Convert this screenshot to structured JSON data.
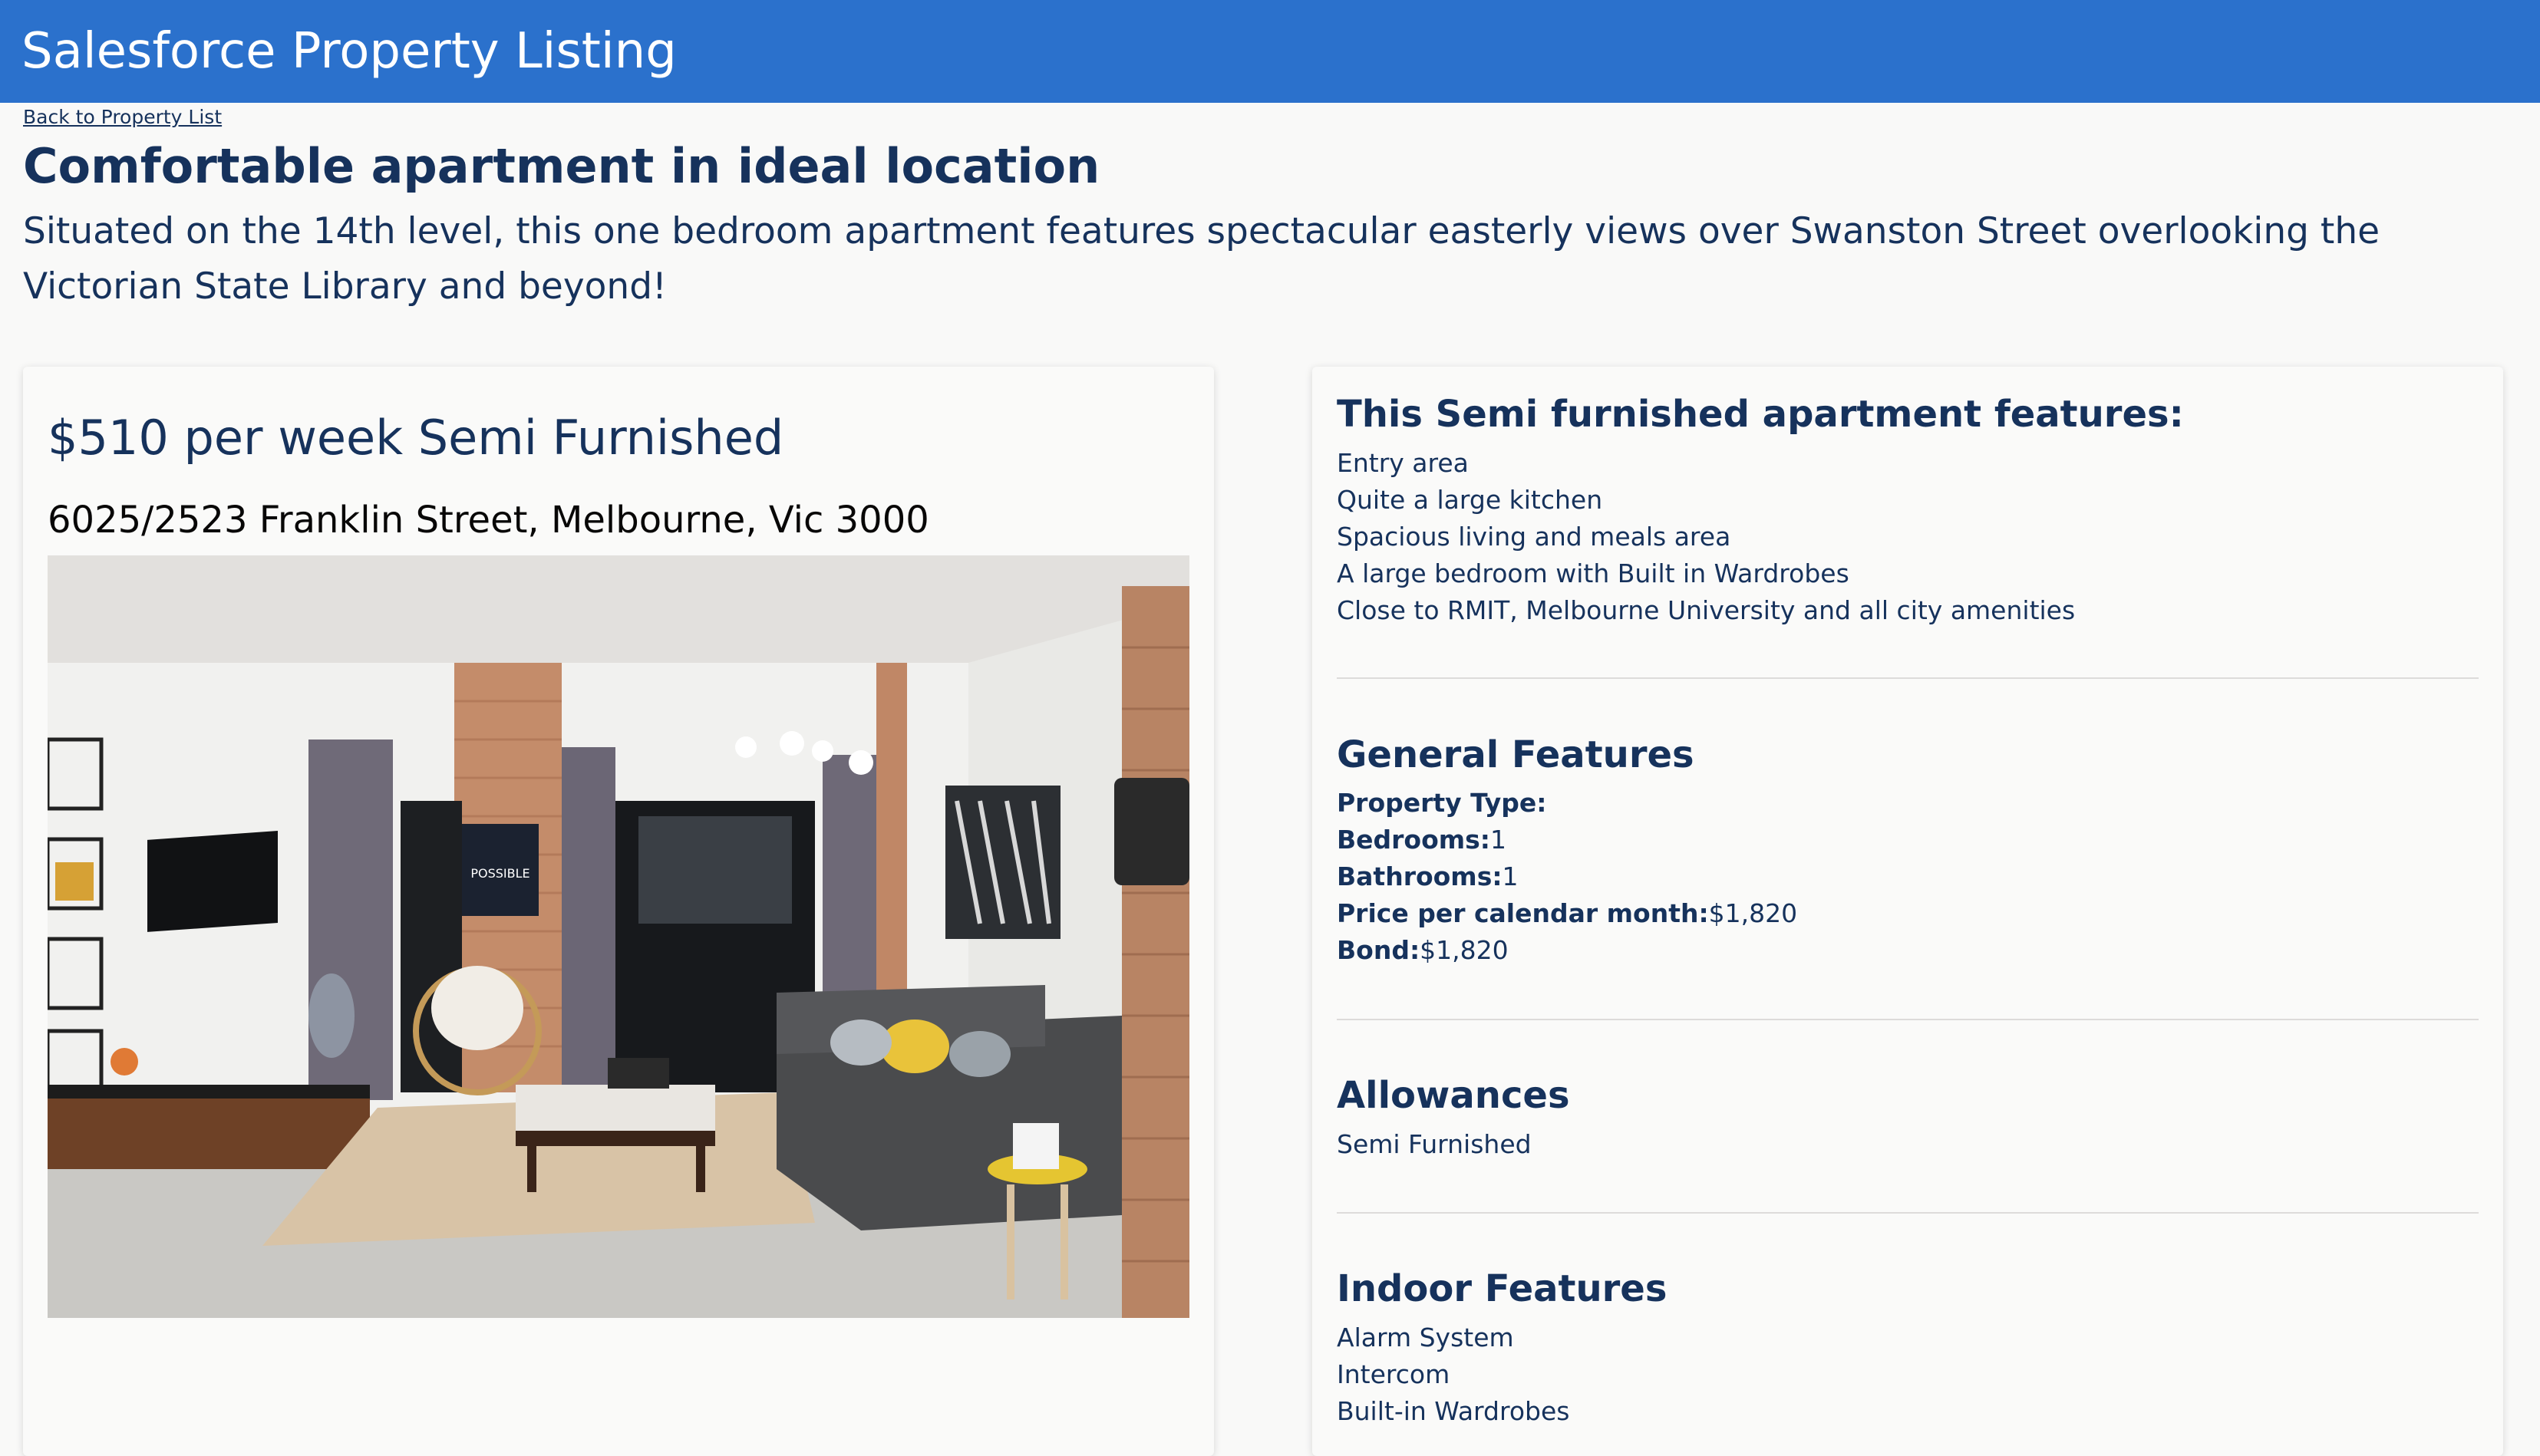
{
  "header": {
    "title": "Salesforce Property Listing"
  },
  "nav": {
    "back_link": "Back to Property List"
  },
  "listing": {
    "title": "Comfortable apartment in ideal location",
    "description": "Situated on the 14th level, this one bedroom apartment features spectacular easterly views over Swanston Street overlooking the Victorian State Library and beyond!",
    "price_line": "$510 per week Semi Furnished",
    "address": "6025/2523 Franklin Street, Melbourne, Vic 3000",
    "photo_caption": "POSSIBLE"
  },
  "features": {
    "heading": "This Semi furnished apartment features:",
    "items": [
      "Entry area",
      "Quite a large kitchen",
      "Spacious living and meals area",
      "A large bedroom with Built in Wardrobes",
      "Close to RMIT, Melbourne University and all city amenities"
    ]
  },
  "general": {
    "heading": "General Features",
    "rows": [
      {
        "label": "Property Type:",
        "value": ""
      },
      {
        "label": "Bedrooms:",
        "value": "1"
      },
      {
        "label": "Bathrooms:",
        "value": "1"
      },
      {
        "label": "Price per calendar month:",
        "value": "$1,820"
      },
      {
        "label": "Bond:",
        "value": "$1,820"
      }
    ]
  },
  "allowances": {
    "heading": "Allowances",
    "items": [
      "Semi Furnished"
    ]
  },
  "indoor": {
    "heading": "Indoor Features",
    "items": [
      "Alarm System",
      "Intercom",
      "Built-in Wardrobes"
    ]
  },
  "colors": {
    "header_bg": "#2b71cc",
    "text_primary": "#16325c",
    "page_bg": "#f9f9f8"
  }
}
